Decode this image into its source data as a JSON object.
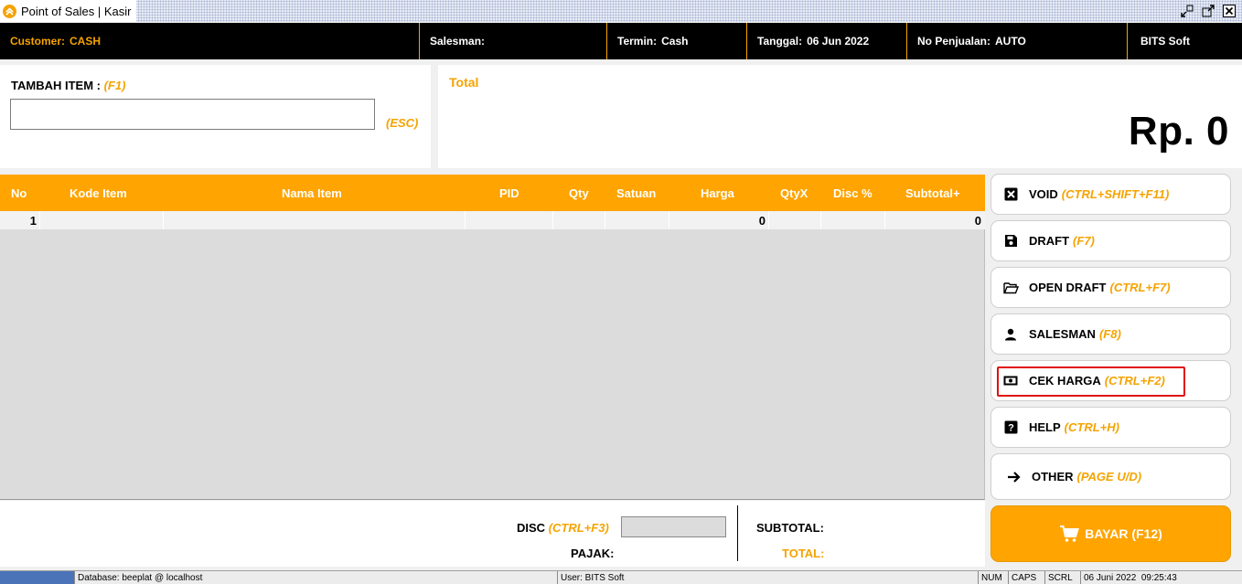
{
  "window": {
    "title": "Point of Sales | Kasir",
    "icons": [
      "app-logo-icon",
      "restore-icon",
      "maximize-icon",
      "close-icon"
    ]
  },
  "header": {
    "customer_label": "Customer:",
    "customer_value": "CASH",
    "salesman_label": "Salesman:",
    "salesman_value": "",
    "termin_label": "Termin:",
    "termin_value": "Cash",
    "tanggal_label": "Tanggal:",
    "tanggal_value": "06 Jun 2022",
    "no_penjualan_label": "No Penjualan:",
    "no_penjualan_value": "AUTO",
    "company": "BITS Soft"
  },
  "tambah_item": {
    "label": "TAMBAH ITEM :",
    "shortcut": "(F1)",
    "value": "",
    "esc_label": "(ESC)"
  },
  "total_panel": {
    "label": "Total",
    "value": "Rp. 0"
  },
  "grid": {
    "columns": [
      "No",
      "Kode Item",
      "Nama Item",
      "PID",
      "Qty",
      "Satuan",
      "Harga",
      "QtyX",
      "Disc %",
      "Subtotal+"
    ],
    "rows": [
      {
        "no": "1",
        "kode": "",
        "nama": "",
        "pid": "",
        "qty": "",
        "satuan": "",
        "harga": "0",
        "qtyx": "",
        "disc": "",
        "subtotal": "0"
      }
    ]
  },
  "actions": [
    {
      "label": "VOID",
      "shortcut": "(CTRL+SHIFT+F11)",
      "icon": "void-icon"
    },
    {
      "label": "DRAFT",
      "shortcut": "(F7)",
      "icon": "save-icon"
    },
    {
      "label": "OPEN DRAFT",
      "shortcut": "(CTRL+F7)",
      "icon": "folder-open-icon"
    },
    {
      "label": "SALESMAN",
      "shortcut": "(F8)",
      "icon": "person-icon"
    },
    {
      "label": "CEK HARGA",
      "shortcut": "(CTRL+F2)",
      "icon": "money-icon"
    },
    {
      "label": "HELP",
      "shortcut": "(CTRL+H)",
      "icon": "help-icon"
    },
    {
      "label": "OTHER",
      "shortcut": "(PAGE U/D)",
      "icon": "arrow-right-icon"
    }
  ],
  "bayar": {
    "label": "BAYAR (F12)",
    "icon": "cart-icon"
  },
  "summary": {
    "disc_label": "DISC",
    "disc_shortcut": "(CTRL+F3)",
    "disc_value": "",
    "pajak_label": "PAJAK:",
    "subtotal_label": "SUBTOTAL:",
    "total_label": "TOTAL:"
  },
  "statusbar": {
    "database": "Database: beeplat @ localhost",
    "user": "User: BITS Soft",
    "num": "NUM",
    "caps": "CAPS",
    "scrl": "SCRL",
    "datetime": "06 Juni 2022  09:25:43"
  },
  "colors": {
    "accent": "#ffa400",
    "header_bg": "#000000",
    "highlight": "#e01010"
  }
}
